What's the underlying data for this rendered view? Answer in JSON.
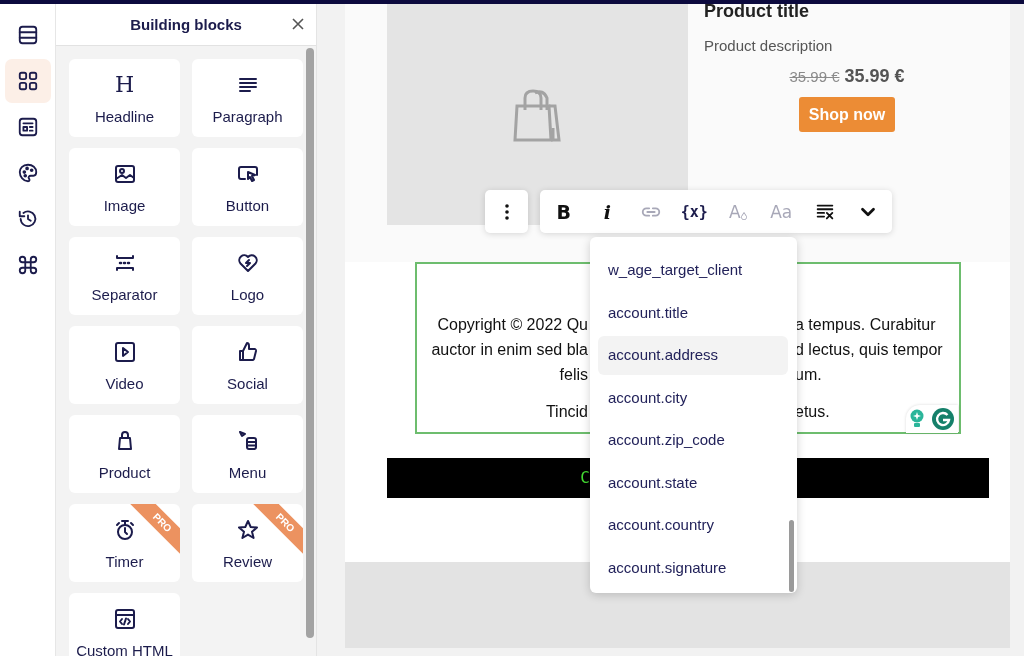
{
  "rail": [
    {
      "selected": false
    },
    {
      "selected": true
    },
    {
      "selected": false
    },
    {
      "selected": false
    },
    {
      "selected": false
    },
    {
      "selected": false
    }
  ],
  "panel": {
    "title": "Building blocks",
    "blocks": [
      {
        "label": "Headline",
        "glyph": "H",
        "pro": false
      },
      {
        "label": "Paragraph",
        "pro": false
      },
      {
        "label": "Image",
        "pro": false
      },
      {
        "label": "Button",
        "pro": false
      },
      {
        "label": "Separator",
        "pro": false
      },
      {
        "label": "Logo",
        "pro": false
      },
      {
        "label": "Video",
        "pro": false
      },
      {
        "label": "Social",
        "pro": false
      },
      {
        "label": "Product",
        "pro": false
      },
      {
        "label": "Menu",
        "pro": false
      },
      {
        "label": "Timer",
        "pro": true,
        "badge": "PRO"
      },
      {
        "label": "Review",
        "pro": true,
        "badge": "PRO"
      },
      {
        "label": "Custom HTML",
        "pro": false
      }
    ]
  },
  "product": {
    "title": "Product title",
    "description": "Product description",
    "old_price": "35.99 €",
    "price": "35.99 €",
    "button": "Shop now"
  },
  "text_block": {
    "lines": [
      {
        "left": "Copyright © 2022 Qu",
        "right": "a tempus. Curabitur"
      },
      {
        "left": "auctor in enim sed bla",
        "right": "d lectus, quis tempor"
      },
      {
        "left": "felis",
        "right": "um."
      },
      {
        "left": "Tincid",
        "right": "etus."
      }
    ]
  },
  "code_bar": {
    "text": "C"
  },
  "toolbar": [
    {
      "kind": "bold",
      "label": "B",
      "disabled": false
    },
    {
      "kind": "italic",
      "label": "i",
      "disabled": false
    },
    {
      "kind": "link",
      "disabled": true
    },
    {
      "kind": "variable",
      "label": "{x}",
      "disabled": false
    },
    {
      "kind": "color",
      "label": "A",
      "disabled": true
    },
    {
      "kind": "font",
      "label": "Aa",
      "disabled": true
    },
    {
      "kind": "clear",
      "disabled": false
    },
    {
      "kind": "more",
      "disabled": false
    }
  ],
  "variables": [
    {
      "label": "w_age_target_client",
      "selected": false
    },
    {
      "label": "account.title",
      "selected": false
    },
    {
      "label": "account.address",
      "selected": true
    },
    {
      "label": "account.city",
      "selected": false
    },
    {
      "label": "account.zip_code",
      "selected": false
    },
    {
      "label": "account.state",
      "selected": false
    },
    {
      "label": "account.country",
      "selected": false
    },
    {
      "label": "account.signature",
      "selected": false
    }
  ]
}
